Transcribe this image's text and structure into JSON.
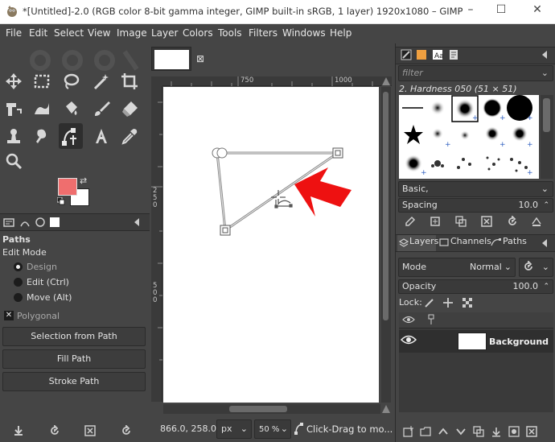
{
  "window": {
    "title": "*[Untitled]-2.0 (RGB color 8-bit gamma integer, GIMP built-in sRGB, 1 layer) 1920x1080 – GIMP",
    "controls": [
      "–",
      "☐",
      "✕"
    ]
  },
  "menubar": {
    "items": [
      "File",
      "Edit",
      "Select",
      "View",
      "Image",
      "Layer",
      "Colors",
      "Tools",
      "Filters",
      "Windows",
      "Help"
    ]
  },
  "colors": {
    "foreground": "#ef6e6e",
    "background": "#ffffff",
    "accent_arrow": "#ee1111"
  },
  "tools": [
    "move-tool-icon",
    "rect-select-icon",
    "lasso-icon",
    "fuzzy-select-icon",
    "crop-icon",
    "transform-icon",
    "warp-icon",
    "bucket-fill-icon",
    "paintbrush-icon",
    "eraser-icon",
    "clone-icon",
    "smudge-icon",
    "paths-icon",
    "text-icon",
    "color-picker-icon",
    "zoom-icon"
  ],
  "tool_options": {
    "title": "Paths",
    "edit_mode_label": "Edit Mode",
    "modes": [
      "Design",
      "Edit (Ctrl)",
      "Move (Alt)"
    ],
    "selected_mode": "Design",
    "polygonal_label": "Polygonal",
    "polygonal_checked": true,
    "buttons": [
      "Selection from Path",
      "Fill Path",
      "Stroke Path"
    ]
  },
  "image_tab": {
    "close_glyph": "⊠"
  },
  "rulers": {
    "h_labels": [
      "750",
      "1000"
    ],
    "v_labels": [
      "2",
      "5",
      "0",
      "5",
      "0",
      "0"
    ]
  },
  "status": {
    "coords": "866.0, 258.0",
    "unit": "px",
    "zoom": "50 %",
    "message": "Click-Drag to mo..."
  },
  "brushes": {
    "filter_placeholder": "filter",
    "current_brush": "2. Hardness 050 (51 × 51)",
    "preset": "Basic,",
    "spacing_label": "Spacing",
    "spacing_value": "10.0"
  },
  "layers": {
    "tabs": [
      "Layers",
      "Channels",
      "Paths"
    ],
    "mode_label": "Mode",
    "mode_value": "Normal",
    "opacity_label": "Opacity",
    "opacity_value": "100.0",
    "lock_label": "Lock:",
    "items": [
      {
        "name": "Background",
        "visible": true
      }
    ]
  }
}
